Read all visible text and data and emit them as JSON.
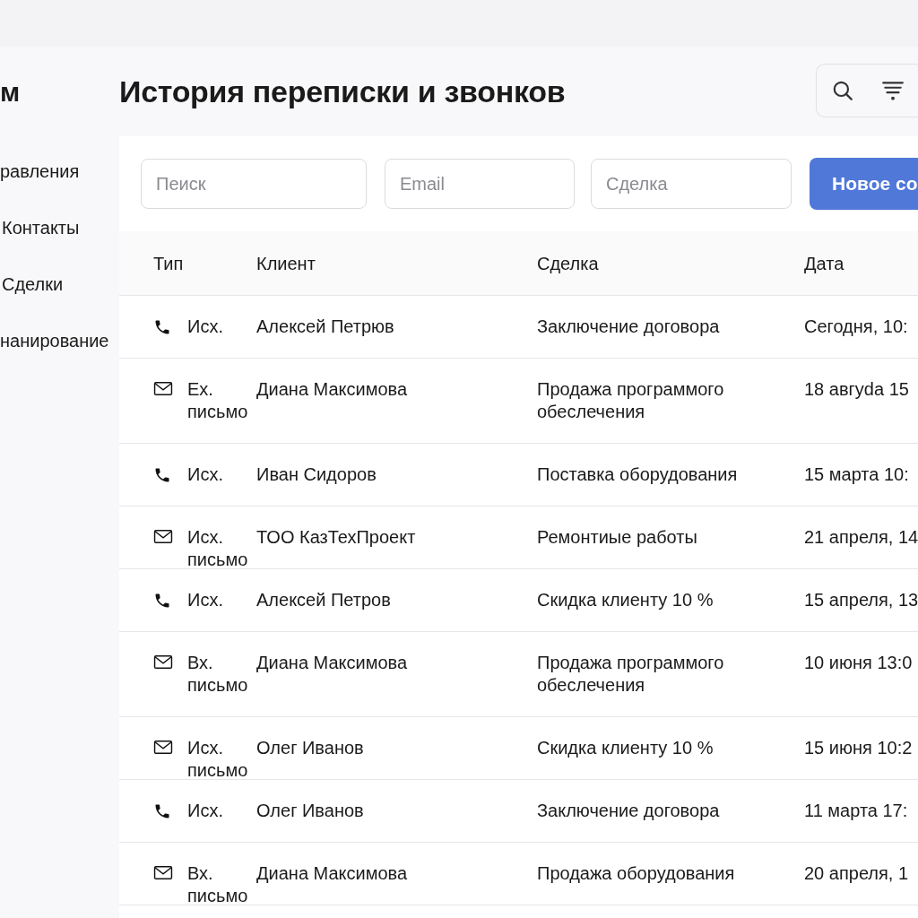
{
  "app": {
    "logo": "м"
  },
  "sidebar": {
    "items": [
      {
        "label": "равления"
      },
      {
        "label": "Контакты"
      },
      {
        "label": "Сделки"
      },
      {
        "label": "нанирование"
      }
    ]
  },
  "page": {
    "title": "История переписки и звонков"
  },
  "filters": [
    {
      "placeholder": "Пеиск"
    },
    {
      "placeholder": "Email"
    },
    {
      "placeholder": "Сделка"
    }
  ],
  "new_button": "Новое со",
  "table": {
    "columns": [
      "Тип",
      "Клиент",
      "Сделка",
      "Дата"
    ],
    "rows": [
      {
        "kind": "call",
        "type": "Исх.",
        "client": "Алексей Петрюв",
        "deal": "Заключение договора",
        "date": "Сегодня, 10:"
      },
      {
        "kind": "mail",
        "type": "Ех. письмо",
        "client": "Диана Максимова",
        "deal": "Продажа программого обеслечения",
        "date": "18 авгуda 15"
      },
      {
        "kind": "call",
        "type": "Исх.",
        "client": "Иван Сидоров",
        "deal": "Поставка оборудования",
        "date": "15 марта 10:"
      },
      {
        "kind": "mail",
        "type": "Исх. письмо",
        "client": "ТОО КазТехПроект",
        "deal": "Ремонтиые работы",
        "date": "21 апреля, 14"
      },
      {
        "kind": "call",
        "type": "Исх.",
        "client": "Алексей Петров",
        "deal": "Скидка клиенту 10 %",
        "date": "15 апреля, 13"
      },
      {
        "kind": "mail",
        "type": "Вх. письмо",
        "client": "Диана Максимова",
        "deal": "Продажа программого обеслечения",
        "date": "10 июня 13:0"
      },
      {
        "kind": "mail",
        "type": "Исх. письмо",
        "client": "Олег Иванов",
        "deal": "Скидка клиенту 10 %",
        "date": "15 июня 10:2"
      },
      {
        "kind": "call",
        "type": "Исх.",
        "client": "Олег Иванов",
        "deal": "Заключение договора",
        "date": "11 марта 17:"
      },
      {
        "kind": "mail",
        "type": "Вх. письмо",
        "client": "Диана Максимова",
        "deal": "Продажа оборудования",
        "date": "20 апреля, 1"
      }
    ]
  }
}
